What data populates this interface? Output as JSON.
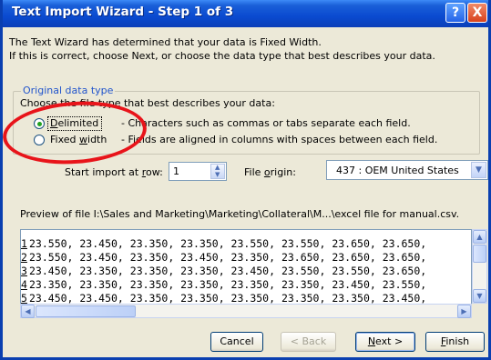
{
  "window": {
    "title": "Text Import Wizard - Step 1 of 3",
    "help_glyph": "?",
    "close_glyph": "X"
  },
  "intro": {
    "line1": "The Text Wizard has determined that your data is Fixed Width.",
    "line2": "If this is correct, choose Next, or choose the data type that best describes your data."
  },
  "original_data_type": {
    "group_label": "Original data type",
    "prompt": "Choose the file type that best describes your data:",
    "options": [
      {
        "label": "Delimited",
        "hotkey": "D",
        "rest": "elimited",
        "selected": true,
        "description": "- Characters such as commas or tabs separate each field."
      },
      {
        "label": "Fixed width",
        "hotkey": "w",
        "before": "Fixed ",
        "after": "idth",
        "selected": false,
        "description": "- Fields are aligned in columns with spaces between each field."
      }
    ]
  },
  "import_options": {
    "start_row_label_pre": "Start import at ",
    "start_row_label_hotkey": "r",
    "start_row_label_post": "ow:",
    "start_row_value": "1",
    "file_origin_label_pre": "File ",
    "file_origin_label_hotkey": "o",
    "file_origin_label_post": "rigin:",
    "file_origin_value": "437 : OEM United States"
  },
  "preview": {
    "caption": "Preview of file I:\\Sales and Marketing\\Marketing\\Collateral\\M...\\excel file for manual.csv.",
    "rows": [
      {
        "num": "1",
        "text": "23.550, 23.450, 23.350, 23.350, 23.550, 23.550, 23.650, 23.650,"
      },
      {
        "num": "2",
        "text": "23.550, 23.450, 23.350, 23.450, 23.350, 23.650, 23.650, 23.650,"
      },
      {
        "num": "3",
        "text": "23.450, 23.350, 23.350, 23.350, 23.450, 23.550, 23.550, 23.650,"
      },
      {
        "num": "4",
        "text": "23.350, 23.350, 23.350, 23.350, 23.350, 23.350, 23.450, 23.550,"
      },
      {
        "num": "5",
        "text": "23.450, 23.450, 23.350, 23.350, 23.350, 23.350, 23.350, 23.450,"
      }
    ]
  },
  "buttons": {
    "cancel": "Cancel",
    "back": "< Back",
    "next_hotkey": "N",
    "next_rest": "ext >",
    "finish_hotkey": "F",
    "finish_rest": "inish"
  },
  "colors": {
    "title_bar": "#0a4ad0",
    "annotation_circle": "#e8141a",
    "radio_selected_dot": "#21a121"
  }
}
